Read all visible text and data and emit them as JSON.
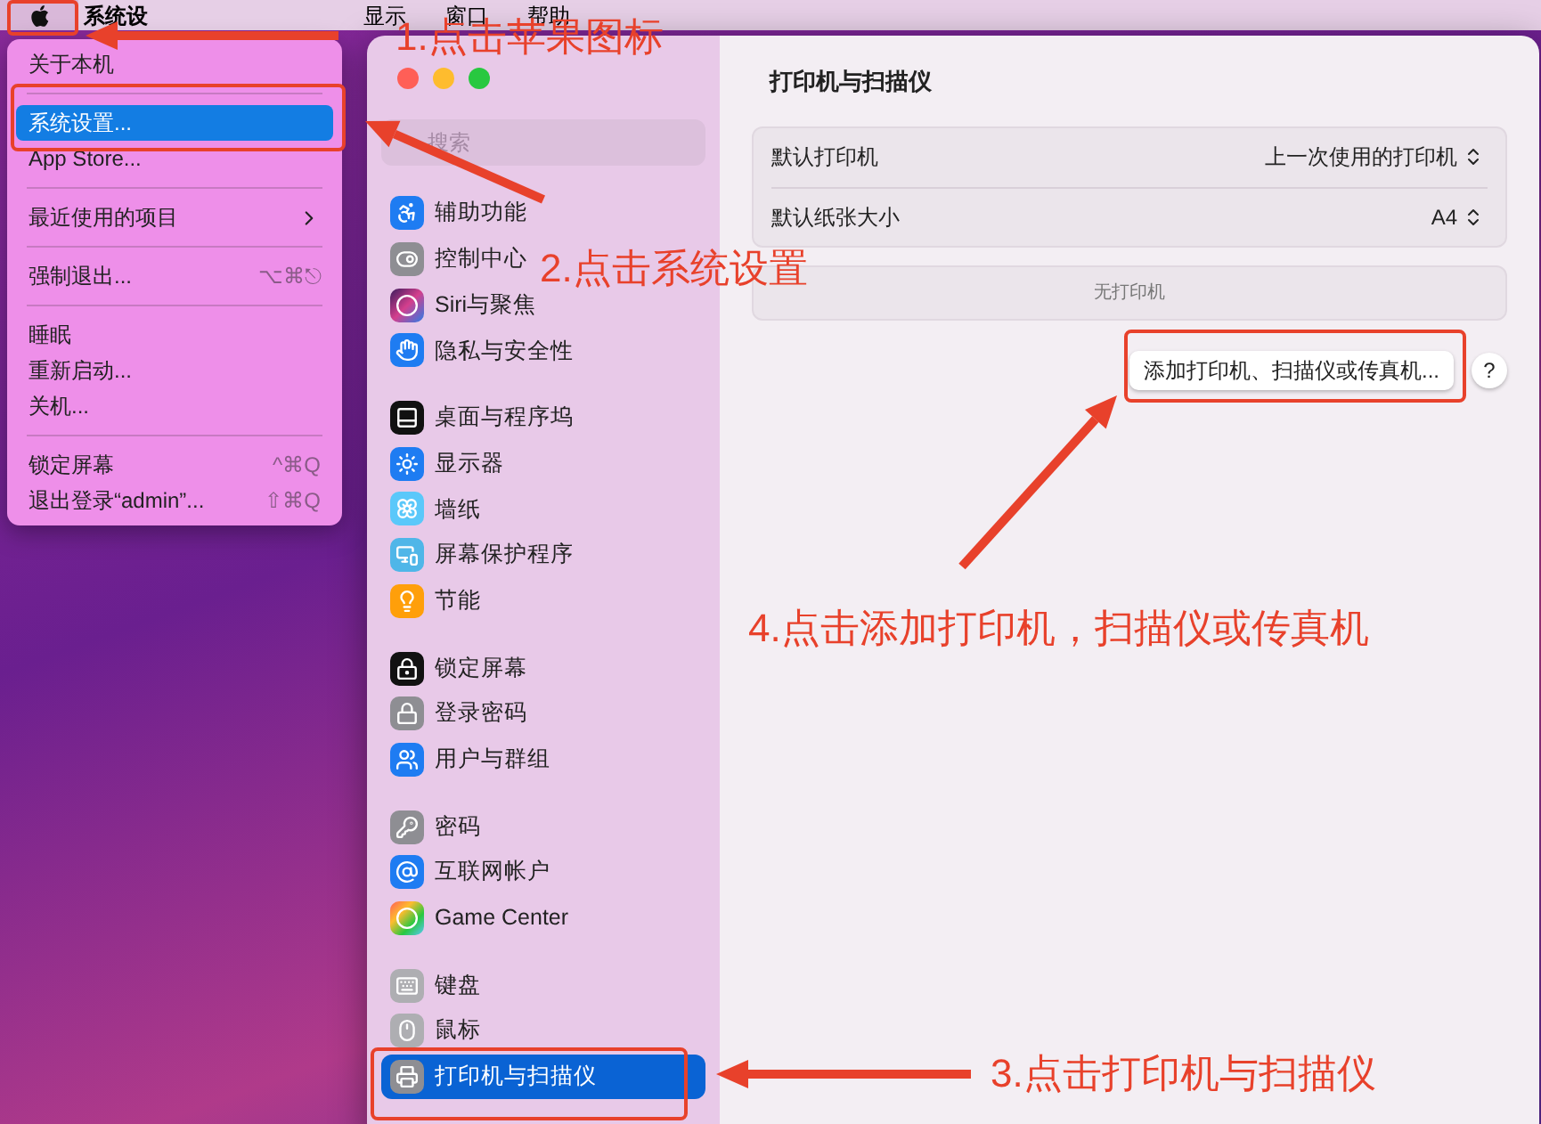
{
  "menu_bar": {
    "items": [
      {
        "label": "系统设",
        "bold": true
      },
      {
        "label": "显示",
        "bold": false
      },
      {
        "label": "窗口",
        "bold": false
      },
      {
        "label": "帮助",
        "bold": false
      }
    ]
  },
  "apple_menu": {
    "items": [
      {
        "kind": "item",
        "label": "关于本机",
        "selected": false
      },
      {
        "kind": "separator"
      },
      {
        "kind": "item",
        "label": "系统设置...",
        "selected": true
      },
      {
        "kind": "item",
        "label": "App Store...",
        "selected": false
      },
      {
        "kind": "separator"
      },
      {
        "kind": "submenu",
        "label": "最近使用的项目",
        "selected": false
      },
      {
        "kind": "separator"
      },
      {
        "kind": "item",
        "label": "强制退出...",
        "shortcut": "⌥⌘⎋",
        "selected": false
      },
      {
        "kind": "separator"
      },
      {
        "kind": "item",
        "label": "睡眠",
        "selected": false
      },
      {
        "kind": "item",
        "label": "重新启动...",
        "selected": false
      },
      {
        "kind": "item",
        "label": "关机...",
        "selected": false
      },
      {
        "kind": "separator"
      },
      {
        "kind": "item",
        "label": "锁定屏幕",
        "shortcut": "^⌘Q",
        "selected": false
      },
      {
        "kind": "item",
        "label": "退出登录“admin”...",
        "shortcut": "⇧⌘Q",
        "selected": false
      }
    ]
  },
  "settings_window": {
    "search": {
      "placeholder": "搜索"
    },
    "sidebar": {
      "groups": [
        [
          {
            "label": "辅助功能",
            "selected": false
          },
          {
            "label": "控制中心",
            "selected": false
          },
          {
            "label": "Siri与聚焦",
            "selected": false
          },
          {
            "label": "隐私与安全性",
            "selected": false
          }
        ],
        [
          {
            "label": "桌面与程序坞",
            "selected": false
          },
          {
            "label": "显示器",
            "selected": false
          },
          {
            "label": "墙纸",
            "selected": false
          },
          {
            "label": "屏幕保护程序",
            "selected": false
          },
          {
            "label": "节能",
            "selected": false
          }
        ],
        [
          {
            "label": "锁定屏幕",
            "selected": false
          },
          {
            "label": "登录密码",
            "selected": false
          },
          {
            "label": "用户与群组",
            "selected": false
          }
        ],
        [
          {
            "label": "密码",
            "selected": false
          },
          {
            "label": "互联网帐户",
            "selected": false
          },
          {
            "label": "Game Center",
            "selected": false
          }
        ],
        [
          {
            "label": "键盘",
            "selected": false
          },
          {
            "label": "鼠标",
            "selected": false
          },
          {
            "label": "打印机与扫描仪",
            "selected": true
          }
        ]
      ]
    },
    "title": "打印机与扫描仪",
    "settings": [
      {
        "label": "默认打印机",
        "value": "上一次使用的打印机"
      },
      {
        "label": "默认纸张大小",
        "value": "A4"
      }
    ],
    "printer_list": {
      "empty_text": "无打印机"
    },
    "add_button": "添加打印机、扫描仪或传真机...",
    "help_button": "?"
  },
  "annotations": [
    {
      "text": "1.点击苹果图标"
    },
    {
      "text": "2.点击系统设置"
    },
    {
      "text": "4.点击添加打印机，扫描仪或传真机"
    },
    {
      "text": "3.点击打印机与扫描仪"
    }
  ]
}
